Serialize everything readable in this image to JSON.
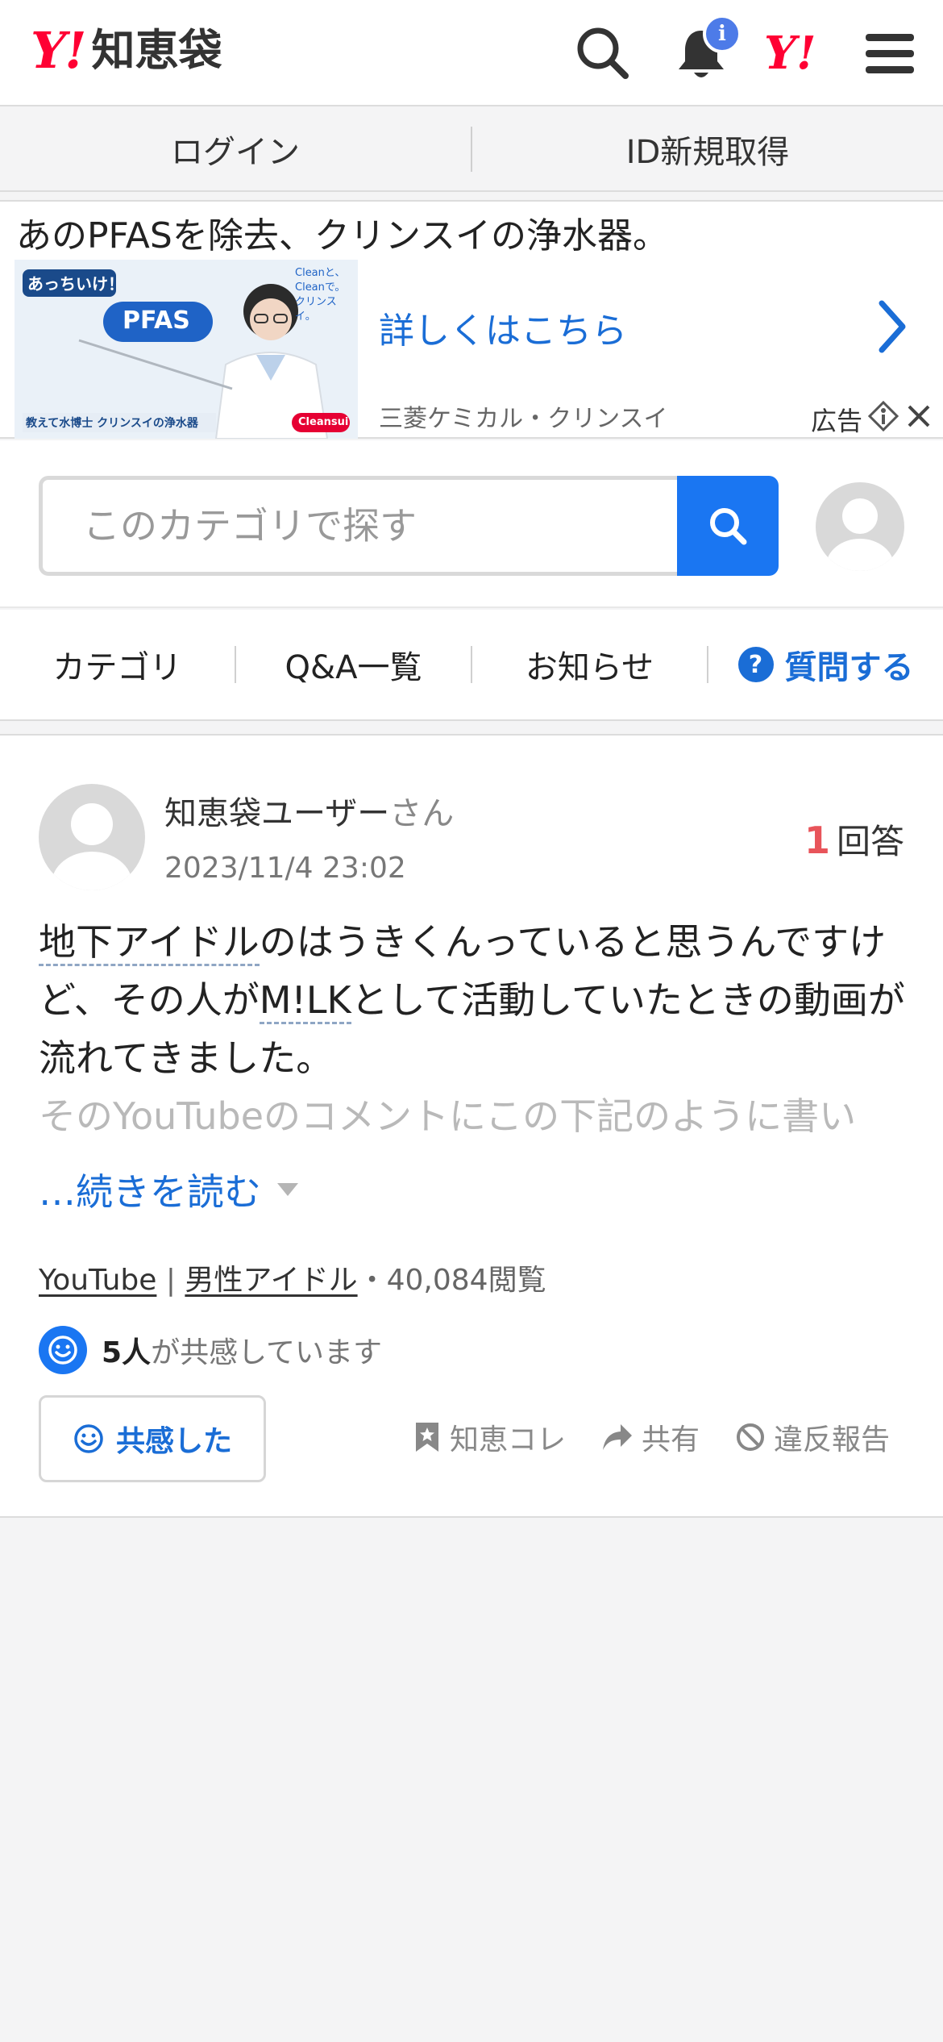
{
  "header": {
    "logo_mark": "Y!",
    "logo_text": "知恵袋",
    "bell_badge": "i",
    "yahoo_mark": "Y!"
  },
  "loginbar": {
    "login": "ログイン",
    "register": "ID新規取得"
  },
  "ad": {
    "title": "あのPFASを除去、クリンスイの浄水器。",
    "link_text": "詳しくはこちら",
    "company": "三菱ケミカル・クリンスイ",
    "label": "広告",
    "image": {
      "badge": "あっちいけ！",
      "pfas": "PFAS",
      "slogan": "Cleanと、Cleanで。クリンスイ。",
      "caption": "教えて水博士 クリンスイの浄水器",
      "brand": "Cleansui"
    }
  },
  "search": {
    "placeholder": "このカテゴリで探す"
  },
  "nav": {
    "category": "カテゴリ",
    "qa_list": "Q&A一覧",
    "news": "お知らせ",
    "ask_icon": "?",
    "ask": "質問する"
  },
  "question": {
    "user": "知恵袋ユーザー",
    "user_suffix": "さん",
    "date": "2023/11/4 23:02",
    "answer_count": "1",
    "answer_label": "回答",
    "body_link1": "地下アイドル",
    "body_part1": "のはうきくんっていると思うんですけど、その人が",
    "body_link2": "M!LK",
    "body_part2": "として活動していたときの動画が流れてきました。",
    "body_faded": "そのYouTubeのコメントにこの下記のように書い",
    "read_more": "…続きを読む",
    "tag1": "YouTube",
    "tag_sep": " | ",
    "tag2": "男性アイドル",
    "views": "・40,084閲覧",
    "empathy_count": "5人",
    "empathy_text": "が共感しています",
    "empathy_button": "共感した",
    "chie_kore": "知恵コレ",
    "share": "共有",
    "report": "違反報告"
  },
  "colors": {
    "yahoo_red": "#ff0033",
    "link_blue": "#1a6dd6",
    "button_blue": "#1a76f2",
    "answer_red": "#e8545a"
  }
}
